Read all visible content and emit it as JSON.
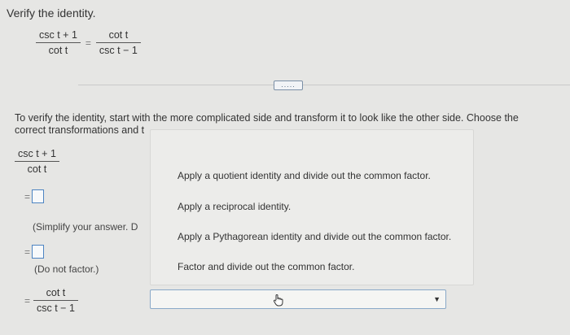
{
  "question": {
    "title": "Verify the identity.",
    "identity": {
      "left": {
        "numerator": "csc t + 1",
        "denominator": "cot t"
      },
      "equals": "=",
      "right": {
        "numerator": "cot t",
        "denominator": "csc t − 1"
      }
    }
  },
  "expand_button": {
    "label": "....."
  },
  "instructions": "To verify the identity, start with the more complicated side and transform it to look like the other side. Choose the correct transformations and t",
  "work": {
    "start": {
      "numerator": "csc t + 1",
      "denominator": "cot t"
    },
    "step1": {
      "equals": "=",
      "hint": "(Simplify your answer. D"
    },
    "step2": {
      "equals": "=",
      "hint": "(Do not factor.)"
    },
    "final": {
      "equals": "=",
      "numerator": "cot t",
      "denominator": "csc t − 1"
    }
  },
  "dropdown": {
    "options": [
      "Apply a quotient identity and divide out the common factor.",
      "Apply a reciprocal identity.",
      "Apply a Pythagorean identity and divide out the common factor.",
      "Factor and divide out the common factor."
    ],
    "selected": "",
    "cursor_icon": "hand-pointer-icon"
  },
  "colors": {
    "accent": "#4d84c2",
    "background": "#e6e6e4"
  }
}
